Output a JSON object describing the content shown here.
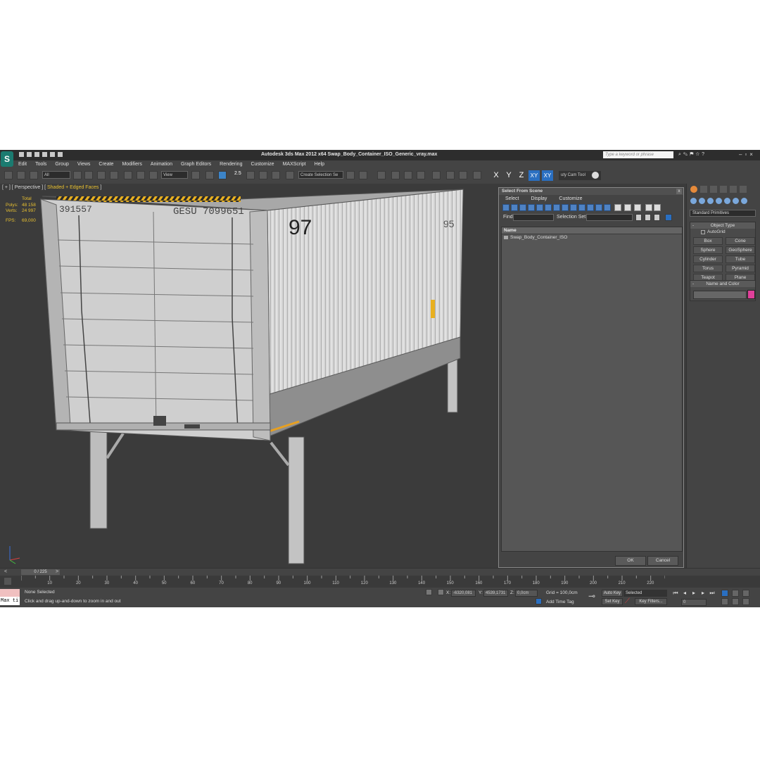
{
  "app": {
    "title": "Autodesk 3ds Max  2012 x64      Swap_Body_Container_ISO_Generic_vray.max",
    "logo_glyph": "S",
    "search_placeholder": "Type a keyword or phrase"
  },
  "menubar": [
    "Edit",
    "Tools",
    "Group",
    "Views",
    "Create",
    "Modifiers",
    "Animation",
    "Graph Editors",
    "Rendering",
    "Customize",
    "MAXScript",
    "Help"
  ],
  "toolbar": {
    "selection_filter": "All",
    "reference_coord": "View",
    "snap_value": "2.5",
    "selection_set": "Create Selection Se",
    "axis_x": "X",
    "axis_y": "Y",
    "axis_z": "Z",
    "axis_xy": "XY",
    "axis_xy2": "XY",
    "cam_tool": "uty Cam Tool"
  },
  "viewport": {
    "label_prefix": "[ + ] [ Perspective ] [ ",
    "label_shading": "Shaded + Edged Faces",
    "label_suffix": " ]",
    "stats": {
      "total_label": "Total",
      "polys_label": "Polys:",
      "polys_value": "48 158",
      "verts_label": "Verts:",
      "verts_value": "24 997",
      "fps_label": "FPS:",
      "fps_value": "69,000"
    },
    "container_text": {
      "code_left": "391557",
      "code_main": "GESU 7099651",
      "side_number": "97",
      "side_number_2": "95"
    }
  },
  "dialog": {
    "title": "Select From Scene",
    "close": "x",
    "menu": [
      "Select",
      "Display",
      "Customize"
    ],
    "find_label": "Find:",
    "selset_label": "Selection Set:",
    "column_name": "Name",
    "items": [
      "Swap_Body_Container_ISO"
    ],
    "ok": "OK",
    "cancel": "Cancel"
  },
  "command_panel": {
    "category": "Standard Primitives",
    "object_type_title": "Object Type",
    "autogrid": "AutoGrid",
    "primitives": [
      "Box",
      "Cone",
      "Sphere",
      "GeoSphere",
      "Cylinder",
      "Tube",
      "Torus",
      "Pyramid",
      "Teapot",
      "Plane"
    ],
    "name_color_title": "Name and Color",
    "object_color": "#e0409a"
  },
  "timeline": {
    "slider": "0 / 225",
    "ticks": [
      "10",
      "20",
      "30",
      "40",
      "50",
      "60",
      "70",
      "80",
      "90",
      "100",
      "110",
      "120",
      "130",
      "140",
      "150",
      "160",
      "170",
      "180",
      "190",
      "200",
      "210",
      "220"
    ]
  },
  "status": {
    "maxscript": "Max ti",
    "selected": "None Selected",
    "prompt": "Click and drag up-and-down to zoom in and out",
    "x_label": "X:",
    "x_value": "-6320,081",
    "y_label": "Y:",
    "y_value": "4539,1731",
    "z_label": "Z:",
    "z_value": "0,0cm",
    "grid": "Grid = 100,0cm",
    "add_time_tag": "Add Time Tag",
    "auto_key": "Auto Key",
    "auto_key_mode": "Selected",
    "set_key": "Set Key",
    "key_filters": "Key Filters...",
    "frame": "0"
  }
}
